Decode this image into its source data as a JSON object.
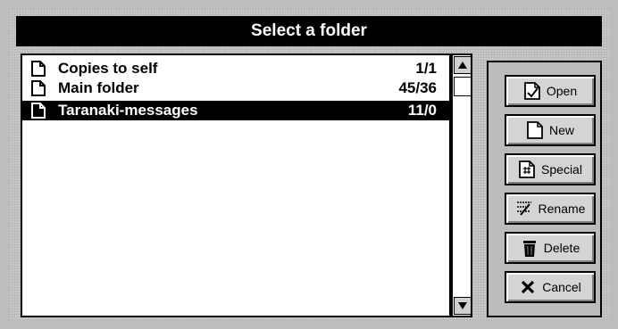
{
  "window": {
    "title": "Select a folder"
  },
  "folders": [
    {
      "name": "Copies to self",
      "count": "1/1",
      "icon": "folder-file-icon",
      "selected": false
    },
    {
      "name": "Main folder",
      "count": "45/36",
      "icon": "folder-file-icon",
      "selected": false
    },
    {
      "name": "Taranaki-messages",
      "count": "11/0",
      "icon": "folder-file-icon",
      "selected": true
    }
  ],
  "buttons": {
    "open": "Open",
    "new": "New",
    "special": "Special",
    "rename": "Rename",
    "delete": "Delete",
    "cancel": "Cancel"
  },
  "scrollbar": {
    "up_icon": "scroll-up-arrow-icon",
    "down_icon": "scroll-down-arrow-icon"
  }
}
